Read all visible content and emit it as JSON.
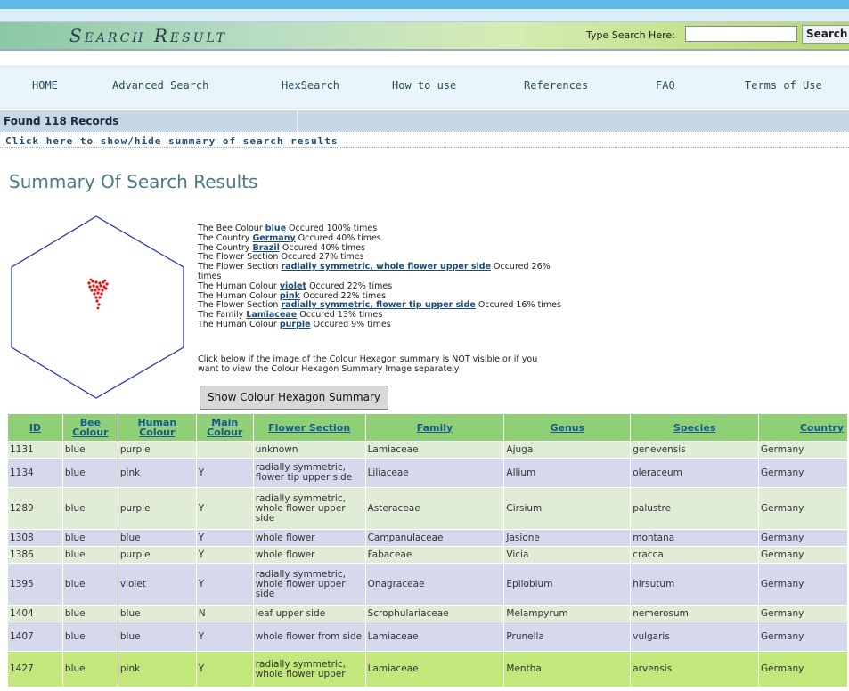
{
  "header": {
    "title": "Search Result",
    "search_label": "Type Search Here:",
    "search_value": "",
    "search_button": "Search"
  },
  "nav": {
    "items": [
      {
        "label": "HOME"
      },
      {
        "label": "Advanced Search"
      },
      {
        "label": "HexSearch"
      },
      {
        "label": "How to use"
      },
      {
        "label": "References"
      },
      {
        "label": "FAQ"
      },
      {
        "label": "Terms of Use"
      }
    ]
  },
  "found": "Found 118 Records",
  "toggle_link": "Click here to show/hide summary of search results",
  "summary": {
    "title": "Summary Of Search Results",
    "lines": [
      {
        "pre": "The Bee Colour ",
        "link": "blue",
        "post": " Occured 100% times"
      },
      {
        "pre": "The Country ",
        "link": "Germany",
        "post": " Occured 40% times"
      },
      {
        "pre": "The Country ",
        "link": "Brazil",
        "post": " Occured 40% times"
      },
      {
        "pre": "The Flower Section Occured 27% times",
        "link": "",
        "post": ""
      },
      {
        "pre": "The Flower Section ",
        "link": "radially symmetric, whole flower upper side",
        "post": " Occured 26%"
      },
      {
        "pre": "times",
        "link": "",
        "post": ""
      },
      {
        "pre": "The Human Colour ",
        "link": "violet",
        "post": " Occured 22% times"
      },
      {
        "pre": "The Human Colour ",
        "link": "pink",
        "post": " Occured 22% times"
      },
      {
        "pre": "The Flower Section ",
        "link": "radially symmetric, flower tip upper side",
        "post": " Occured 16% times"
      },
      {
        "pre": "The Family ",
        "link": "Lamiaceae",
        "post": " Occured 13% times"
      },
      {
        "pre": "The Human Colour ",
        "link": "purple",
        "post": " Occured 9% times"
      }
    ],
    "note_1": "Click below if the image of the Colour Hexagon summary is NOT visible or if you",
    "note_2": "want to view the Colour Hexagon Summary Image separately",
    "button": "Show Colour Hexagon Summary"
  },
  "table": {
    "headers": {
      "id": "ID",
      "bee_1": "Bee",
      "bee_2": "Colour",
      "human_1": "Human",
      "human_2": "Colour",
      "main_1": "Main",
      "main_2": "Colour",
      "section": "Flower Section",
      "family": "Family",
      "genus": "Genus",
      "species": "Species",
      "country": "Country"
    },
    "rows": [
      {
        "id": "1131",
        "bee": "blue",
        "human": "purple",
        "main": "",
        "section": "unknown",
        "family": "Lamiaceae",
        "genus": "Ajuga",
        "species": "genevensis",
        "country": "Germany",
        "style": "green"
      },
      {
        "id": "1134",
        "bee": "blue",
        "human": "pink",
        "main": "Y",
        "section": "radially symmetric, flower tip upper side",
        "family": "Liliaceae",
        "genus": "Allium",
        "species": "oleraceum",
        "country": "Germany",
        "style": "lav"
      },
      {
        "id": "1289",
        "bee": "blue",
        "human": "purple",
        "main": "Y",
        "section": "radially symmetric, whole flower upper side",
        "family": "Asteraceae",
        "genus": "Cirsium",
        "species": "palustre",
        "country": "Germany",
        "style": "green"
      },
      {
        "id": "1308",
        "bee": "blue",
        "human": "blue",
        "main": "Y",
        "section": "whole flower",
        "family": "Campanulaceae",
        "genus": "Jasione",
        "species": "montana",
        "country": "Germany",
        "style": "lav"
      },
      {
        "id": "1386",
        "bee": "blue",
        "human": "purple",
        "main": "Y",
        "section": "whole flower",
        "family": "Fabaceae",
        "genus": "Vicia",
        "species": "cracca",
        "country": "Germany",
        "style": "green"
      },
      {
        "id": "1395",
        "bee": "blue",
        "human": "violet",
        "main": "Y",
        "section": "radially symmetric, whole flower upper side",
        "family": "Onagraceae",
        "genus": "Epilobium",
        "species": "hirsutum",
        "country": "Germany",
        "style": "lav"
      },
      {
        "id": "1404",
        "bee": "blue",
        "human": "blue",
        "main": "N",
        "section": "leaf upper side",
        "family": "Scrophulariaceae",
        "genus": "Melampyrum",
        "species": "nemerosum",
        "country": "Germany",
        "style": "green"
      },
      {
        "id": "1407",
        "bee": "blue",
        "human": "blue",
        "main": "Y",
        "section": "whole flower from side",
        "family": "Lamiaceae",
        "genus": "Prunella",
        "species": "vulgaris",
        "country": "Germany",
        "style": "lav"
      },
      {
        "id": "1427",
        "bee": "blue",
        "human": "pink",
        "main": "Y",
        "section": "radially symmetric, whole flower upper",
        "family": "Lamiaceae",
        "genus": "Mentha",
        "species": "arvensis",
        "country": "Germany",
        "style": "lime"
      }
    ]
  },
  "colors": {
    "header_green": "#8fd077",
    "row_green": "#e1ecd6",
    "row_lavender": "#d6d9ec",
    "row_highlight": "#c2e77a",
    "hexagon_stroke": "#2a3aa8",
    "dot_red": "#dd1111"
  }
}
